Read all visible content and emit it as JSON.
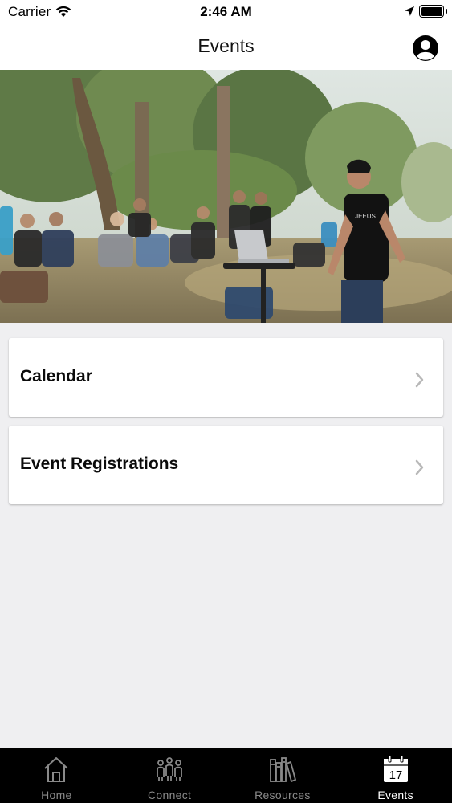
{
  "status_bar": {
    "carrier": "Carrier",
    "time": "2:46 AM"
  },
  "nav": {
    "title": "Events"
  },
  "menu": [
    {
      "label": "Calendar"
    },
    {
      "label": "Event Registrations"
    }
  ],
  "tabs": [
    {
      "label": "Home",
      "icon": "home-icon"
    },
    {
      "label": "Connect",
      "icon": "people-icon"
    },
    {
      "label": "Resources",
      "icon": "books-icon"
    },
    {
      "label": "Events",
      "icon": "calendar-icon",
      "date": "17",
      "active": true
    }
  ],
  "colors": {
    "background": "#efeff1",
    "tab_bar": "#000000",
    "tab_inactive": "#8a8a8a",
    "tab_active": "#ffffff"
  }
}
